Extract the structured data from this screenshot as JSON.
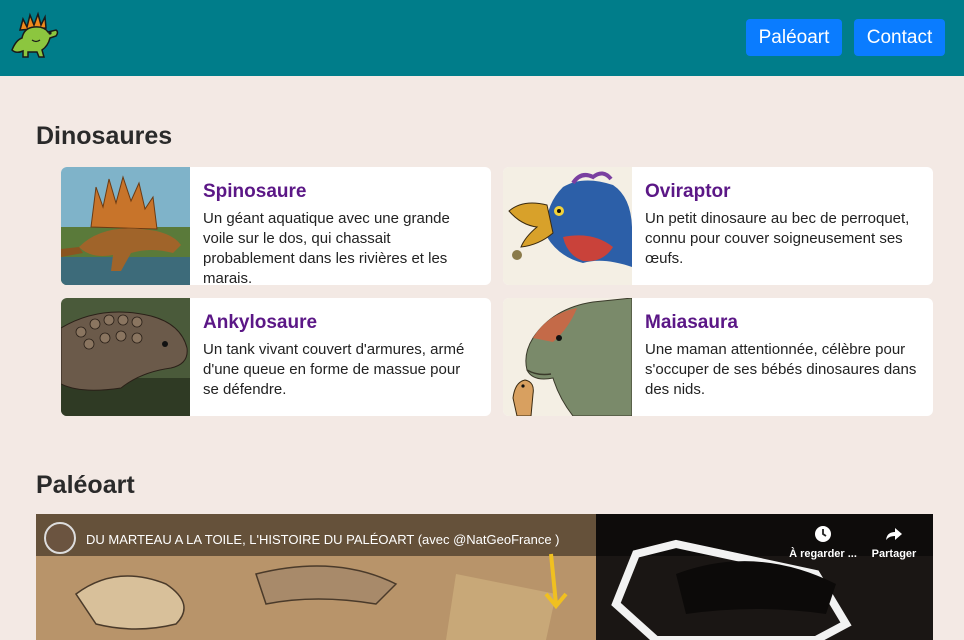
{
  "header": {
    "logo_icon": "dinosaur-logo-icon",
    "nav": [
      {
        "label": "Paléoart"
      },
      {
        "label": "Contact"
      }
    ],
    "colors": {
      "bar": "#007d8a",
      "button": "#0a7cff"
    }
  },
  "sections": {
    "dinosaurs_title": "Dinosaures",
    "paleoart_title": "Paléoart"
  },
  "cards": [
    {
      "title": "Spinosaure",
      "description": "Un géant aquatique avec une grande voile sur le dos, qui chassait probablement dans les rivières et les marais."
    },
    {
      "title": "Oviraptor",
      "description": "Un petit dinosaure au bec de perroquet, connu pour couver soigneusement ses œufs."
    },
    {
      "title": "Ankylosaure",
      "description": "Un tank vivant couvert d'armures, armé d'une queue en forme de massue pour se défendre."
    },
    {
      "title": "Maiasaura",
      "description": "Une maman attentionnée, célèbre pour s'occuper de ses bébés dinosaures dans des nids."
    }
  ],
  "video": {
    "title": "DU MARTEAU A LA TOILE, L'HISTOIRE DU PALÉOART (avec @NatGeoFrance )",
    "watch_later": "À regarder ...",
    "share": "Partager"
  }
}
